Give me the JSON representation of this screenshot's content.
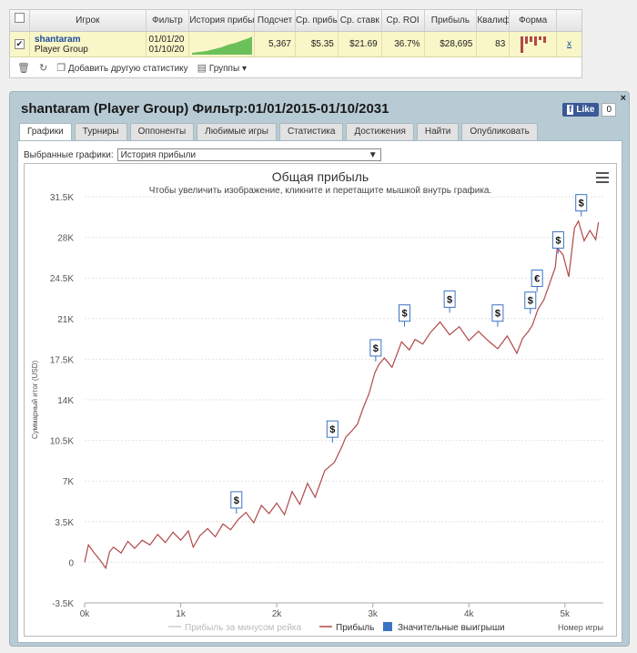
{
  "stats_table": {
    "headers": [
      "Игрок",
      "Фильтр",
      "История прибы",
      "Подсчет",
      "Ср. прибы",
      "Ср. ставк",
      "Ср. ROI",
      "Прибыль",
      "Квалиф",
      "Форма"
    ],
    "row": {
      "player_name": "shantaram",
      "player_group": "Player Group",
      "filter_from": "01/01/20",
      "filter_to": "01/10/20",
      "count": "5,367",
      "avg_profit": "$5.35",
      "avg_stake": "$21.69",
      "avg_roi": "36.7%",
      "profit": "$28,695",
      "qual": "83",
      "remove": "x"
    },
    "footer": {
      "add_stat": "Добавить другую статистику",
      "groups": "Группы"
    }
  },
  "panel": {
    "title": "shantaram (Player Group) Фильтр:01/01/2015-01/10/2031",
    "fb_like": "Like",
    "fb_count": "0",
    "close": "×",
    "tabs": [
      "Графики",
      "Турниры",
      "Оппоненты",
      "Любимые игры",
      "Статистика",
      "Достижения",
      "Найти",
      "Опубликовать"
    ],
    "active_tab": 0,
    "selector_label": "Выбранные графики:",
    "selector_value": "История прибыли"
  },
  "chart_data": {
    "type": "line",
    "title": "Общая прибыль",
    "subtitle": "Чтобы увеличить изображение, кликните и перетащите мышкой внутрь графика.",
    "xlabel": "Номер игры",
    "ylabel": "Суммарный итог (USD)",
    "xlim": [
      0,
      5400
    ],
    "ylim": [
      -3500,
      31500
    ],
    "x_ticks": [
      "0k",
      "1k",
      "2k",
      "3k",
      "4k",
      "5k"
    ],
    "y_ticks": [
      "31.5K",
      "28K",
      "24.5K",
      "21K",
      "17.5K",
      "14K",
      "10.5K",
      "7K",
      "3.5K",
      "0",
      "-3.5K"
    ],
    "grid": true,
    "legend_position": "bottom",
    "legend": [
      "Прибыль за минусом рейка",
      "Прибыль",
      "Значительные выигрыши"
    ],
    "colors": {
      "profit": "#b04848",
      "rake": "#cccccc",
      "big_win": "#3b73c4"
    },
    "series": [
      {
        "name": "Прибыль",
        "x": [
          0,
          40,
          100,
          160,
          220,
          260,
          300,
          380,
          450,
          520,
          600,
          680,
          760,
          840,
          920,
          1000,
          1080,
          1130,
          1200,
          1280,
          1360,
          1440,
          1520,
          1600,
          1680,
          1760,
          1840,
          1920,
          2000,
          2080,
          2160,
          2240,
          2320,
          2400,
          2500,
          2600,
          2680,
          2720,
          2780,
          2840,
          2900,
          2960,
          3020,
          3060,
          3120,
          3200,
          3300,
          3380,
          3440,
          3520,
          3600,
          3700,
          3800,
          3900,
          4000,
          4100,
          4200,
          4300,
          4400,
          4500,
          4560,
          4620,
          4660,
          4720,
          4780,
          4840,
          4900,
          4920,
          4980,
          5040,
          5100,
          5140,
          5200,
          5260,
          5320,
          5350
        ],
        "y": [
          0,
          1500,
          800,
          200,
          -500,
          900,
          1300,
          800,
          1800,
          1200,
          1900,
          1500,
          2400,
          1700,
          2600,
          1900,
          2700,
          1300,
          2300,
          2900,
          2200,
          3300,
          2800,
          3700,
          4300,
          3400,
          4900,
          4200,
          5100,
          4100,
          6100,
          5000,
          6800,
          5600,
          7900,
          8600,
          10000,
          10800,
          11300,
          11900,
          13300,
          14500,
          16300,
          17000,
          17600,
          16800,
          19000,
          18300,
          19200,
          18800,
          19800,
          20700,
          19600,
          20300,
          19100,
          19900,
          19100,
          18400,
          19500,
          18000,
          19300,
          19900,
          20400,
          21800,
          22600,
          24000,
          25400,
          27100,
          26500,
          24600,
          28800,
          29400,
          27700,
          28600,
          27800,
          29300
        ]
      },
      {
        "name": "Значительные выигрыши",
        "x": [
          1580,
          2580,
          3030,
          3330,
          3800,
          4300,
          4640,
          4710,
          4930,
          5170
        ],
        "y": [
          4200,
          10300,
          17300,
          20300,
          21500,
          20300,
          21400,
          23300,
          26600,
          29800
        ]
      }
    ]
  }
}
